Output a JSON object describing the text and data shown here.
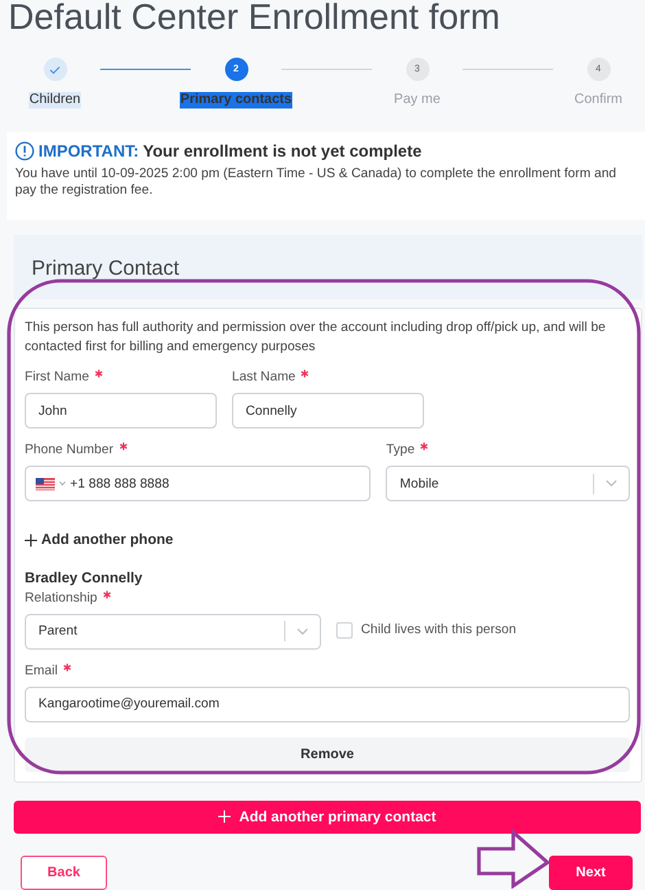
{
  "title": "Default Center Enrollment form",
  "steps": [
    {
      "label": "Children",
      "completed": true,
      "selected": false
    },
    {
      "number": "2",
      "label": "Primary contacts",
      "completed": false,
      "selected": true
    },
    {
      "number": "3",
      "label": "Pay me",
      "completed": false,
      "selected": false
    },
    {
      "number": "4",
      "label": "Confirm",
      "completed": false,
      "selected": false
    }
  ],
  "notice": {
    "label": "IMPORTANT:",
    "title": "Your enrollment is not yet complete",
    "text": "You have until 10-09-2025 2:00 pm (Eastern Time - US & Canada) to complete the enrollment form and pay the registration fee."
  },
  "primary_contact": {
    "heading": "Primary Contact",
    "description": "This person has full authority and permission over the account including drop off/pick up, and will be contacted first for billing and emergency purposes",
    "first_name": {
      "kind": "text",
      "label": "First Name",
      "required": true,
      "value": "John"
    },
    "last_name": {
      "kind": "text",
      "label": "Last Name",
      "required": true,
      "value": "Connelly"
    },
    "phone": {
      "kind": "phone",
      "label": "Phone Number",
      "required": true,
      "value": "+1 888 888 8888"
    },
    "phone_type": {
      "kind": "select",
      "label": "Type",
      "required": true,
      "value": "Mobile"
    },
    "add_phone": "Add another phone",
    "child_name": "Bradley Connelly",
    "relationship": {
      "kind": "select",
      "label": "Relationship",
      "required": true,
      "value": "Parent"
    },
    "lives_with": {
      "label": "Child lives with this person",
      "checked": false
    },
    "email": {
      "kind": "text",
      "label": "Email",
      "required": true,
      "value": "Kangarootime@youremail.com"
    },
    "remove": "Remove"
  },
  "add_contact": "Add another primary contact",
  "actions": {
    "back": "Back",
    "next": "Next"
  }
}
